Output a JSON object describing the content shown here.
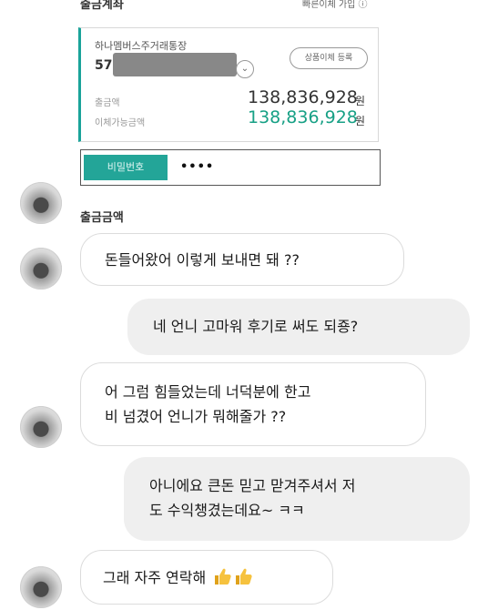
{
  "bank_screenshot": {
    "section_title": "출금계좌",
    "quick_transfer_link": "빠른이체 가입 ⓘ",
    "account_name": "하나멤버스주거래통장",
    "account_number_visible": "57",
    "register_button": "상품이체 등록",
    "balance_label": "출금액",
    "balance_amount": "138,836,928",
    "balance_unit": "원",
    "available_label": "이체가능금액",
    "available_amount": "138,836,928",
    "available_unit": "원",
    "password_label": "비밀번호",
    "password_value": "••••",
    "withdraw_amount_label": "출금금액"
  },
  "messages": [
    {
      "side": "in",
      "text": "돈들어왔어 이렇게 보내면 돼 ??"
    },
    {
      "side": "out",
      "text": "네 언니 고마워 후기로 써도 되죵?"
    },
    {
      "side": "in",
      "lines": [
        "어 그럼 힘들었는데 너덕분에 한고",
        "비 넘겼어 언니가 뭐해줄가 ??"
      ]
    },
    {
      "side": "out",
      "lines": [
        "아니에요 큰돈 믿고 맏겨주셔서 저",
        "도 수익챙겼는데요~ ㅋㅋ"
      ]
    },
    {
      "side": "in",
      "text": "그래 자주 연락해",
      "emoji": "thumbs-up x2"
    }
  ]
}
